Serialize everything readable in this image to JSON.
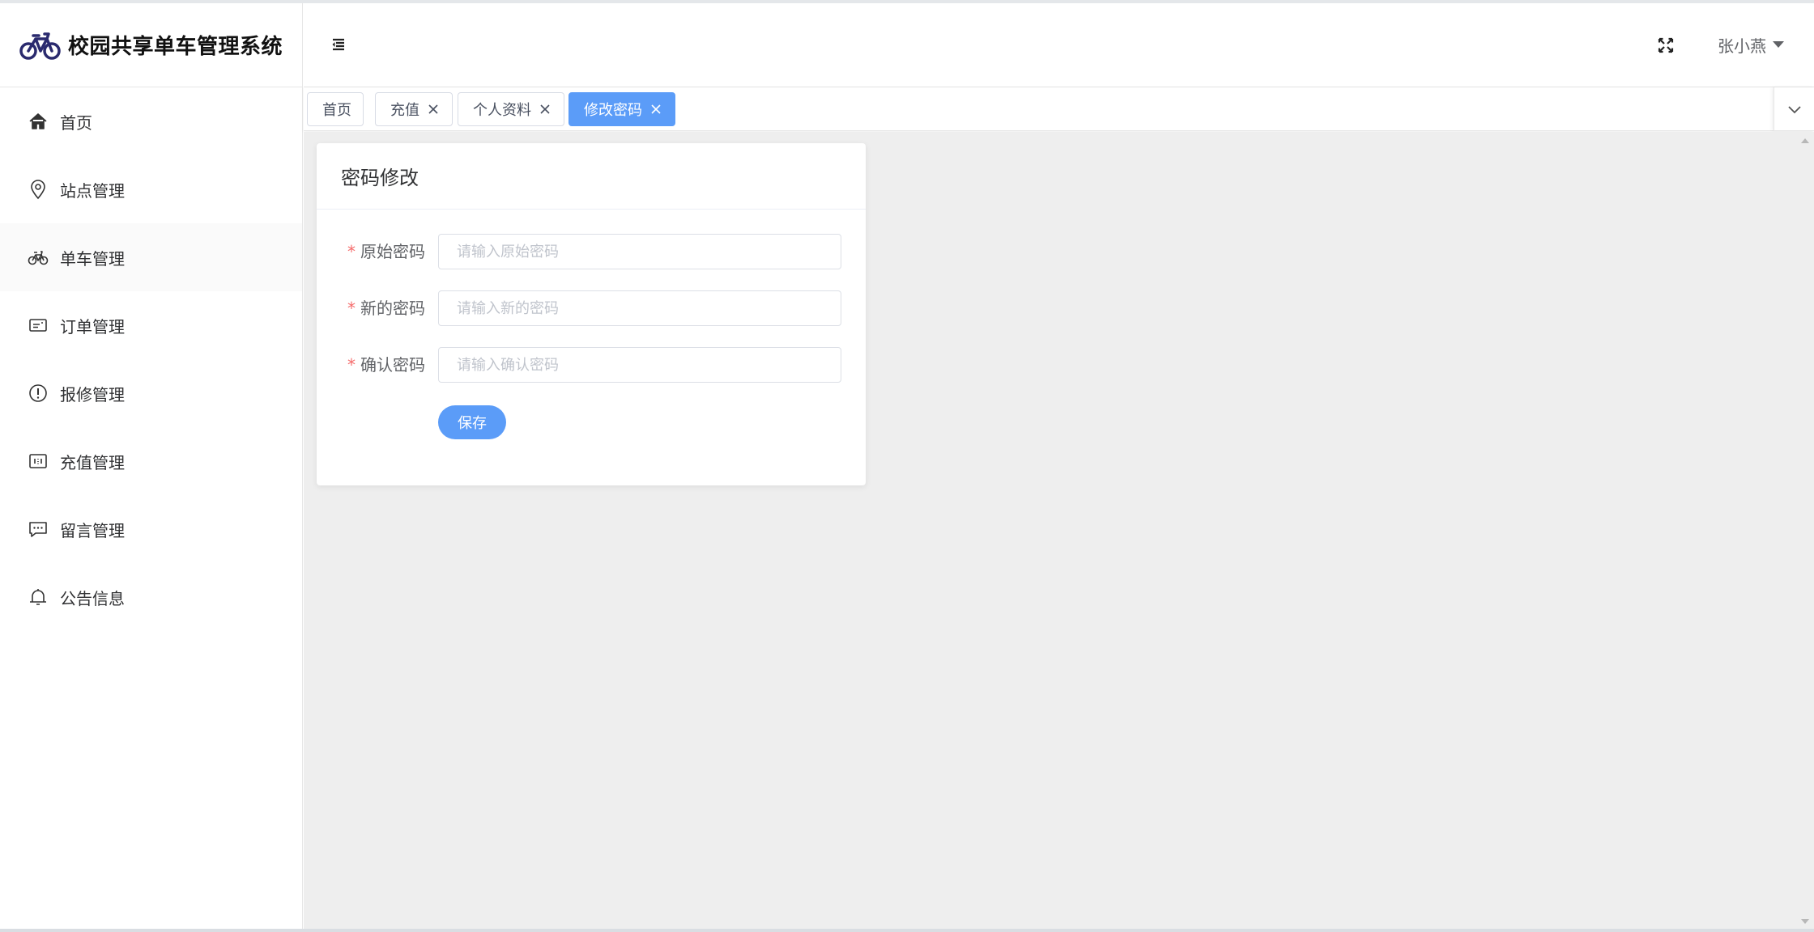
{
  "app": {
    "title": "校园共享单车管理系统"
  },
  "sidebar": {
    "items": [
      {
        "label": "首页",
        "icon": "home-icon"
      },
      {
        "label": "站点管理",
        "icon": "location-icon"
      },
      {
        "label": "单车管理",
        "icon": "bicycle-icon"
      },
      {
        "label": "订单管理",
        "icon": "ticket-icon"
      },
      {
        "label": "报修管理",
        "icon": "warning-icon"
      },
      {
        "label": "充值管理",
        "icon": "recharge-icon"
      },
      {
        "label": "留言管理",
        "icon": "chat-icon"
      },
      {
        "label": "公告信息",
        "icon": "bell-icon"
      }
    ]
  },
  "header": {
    "user_name": "张小燕"
  },
  "tags": [
    {
      "label": "首页",
      "closable": false,
      "active": false
    },
    {
      "label": "充值",
      "closable": true,
      "active": false
    },
    {
      "label": "个人资料",
      "closable": true,
      "active": false
    },
    {
      "label": "修改密码",
      "closable": true,
      "active": true
    }
  ],
  "form": {
    "title": "密码修改",
    "fields": [
      {
        "label": "原始密码",
        "placeholder": "请输入原始密码",
        "required": "*"
      },
      {
        "label": "新的密码",
        "placeholder": "请输入新的密码",
        "required": "*"
      },
      {
        "label": "确认密码",
        "placeholder": "请输入确认密码",
        "required": "*"
      }
    ],
    "save_label": "保存"
  },
  "colors": {
    "primary": "#5b9cf8",
    "required": "#f56c6c",
    "main_bg": "#eeeeee"
  }
}
